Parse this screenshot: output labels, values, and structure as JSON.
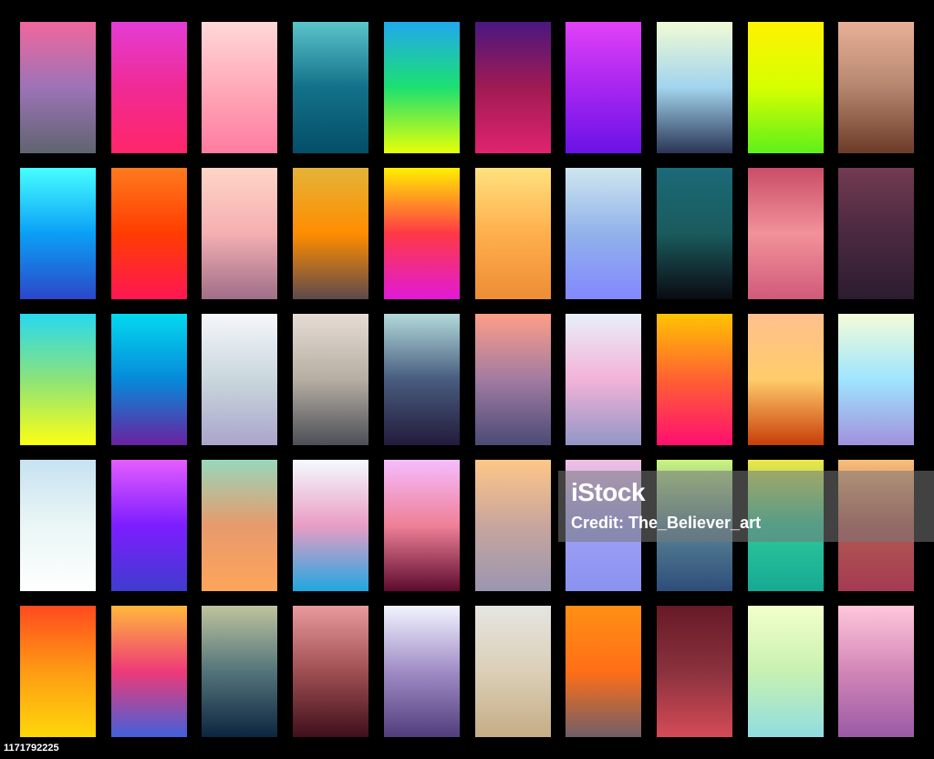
{
  "watermark": {
    "logo": "iStock",
    "credit": "Credit: The_Believer_art"
  },
  "image_id": "1171792225",
  "swatches": [
    [
      "#f0679d",
      "#9d73b7",
      "#5f6470"
    ],
    [
      "#e33dd6",
      "#f02a95",
      "#ff2669"
    ],
    [
      "#ffd8d8",
      "#ffaab8",
      "#ff7ba0"
    ],
    [
      "#5bc4cb",
      "#137189",
      "#044e68"
    ],
    [
      "#21a8ee",
      "#1ce070",
      "#e8ff08"
    ],
    [
      "#4a1780",
      "#a01b53",
      "#e0236f"
    ],
    [
      "#e142f6",
      "#a725f0",
      "#6a12e6"
    ],
    [
      "#f1fbd4",
      "#a2d4ee",
      "#2a3555"
    ],
    [
      "#fff200",
      "#d6ff00",
      "#5ef01a"
    ],
    [
      "#e9b098",
      "#b5866e",
      "#6d3b29"
    ],
    [
      "#47ffff",
      "#0aa0f6",
      "#2b47c9"
    ],
    [
      "#ff7a1e",
      "#ff3d00",
      "#ff1654"
    ],
    [
      "#ffd5c7",
      "#f4afb1",
      "#9f6e89"
    ],
    [
      "#e4b338",
      "#ff8d00",
      "#5d494c"
    ],
    [
      "#ffef00",
      "#ff3847",
      "#e01ad7"
    ],
    [
      "#ffe17e",
      "#ffaf4d",
      "#ed8d35"
    ],
    [
      "#cfe6ee",
      "#91b2ea",
      "#8387ff"
    ],
    [
      "#1b6a78",
      "#1a5b5d",
      "#0a0a12"
    ],
    [
      "#ca4d67",
      "#f29299",
      "#d05a7a"
    ],
    [
      "#723b52",
      "#4a2940",
      "#2c1c30"
    ],
    [
      "#28d9ef",
      "#8be37a",
      "#fcff13"
    ],
    [
      "#03d9ef",
      "#068ad9",
      "#6a22a0"
    ],
    [
      "#f5f7fc",
      "#c9d7dc",
      "#aaa5cb"
    ],
    [
      "#e6dcd5",
      "#b6aea2",
      "#4b4f56"
    ],
    [
      "#b3dada",
      "#485c7f",
      "#231b3b"
    ],
    [
      "#ff9e87",
      "#a27ba1",
      "#4a4b76"
    ],
    [
      "#e8f0fa",
      "#f3b2d8",
      "#9296c6"
    ],
    [
      "#ffc400",
      "#ff6132",
      "#ff0f70"
    ],
    [
      "#ffc08e",
      "#ffcc6a",
      "#c83d0a"
    ],
    [
      "#f4fcd8",
      "#9fe5ff",
      "#a191dd"
    ],
    [
      "#c7e2f2",
      "#eaf6f5",
      "#ffffff"
    ],
    [
      "#e55dff",
      "#7d1dff",
      "#3f3ccf"
    ],
    [
      "#97d8ba",
      "#e79a6d",
      "#ffa55a"
    ],
    [
      "#f4fbff",
      "#e99dc4",
      "#1fa7e0"
    ],
    [
      "#f5bdff",
      "#ef8097",
      "#5c0b2e"
    ],
    [
      "#ffc787",
      "#c8a59d",
      "#9a96b0"
    ],
    [
      "#f2bfe4",
      "#9fa0f4",
      "#8a92f0"
    ],
    [
      "#cbf57f",
      "#5a8596",
      "#2e4d7a"
    ],
    [
      "#f1e646",
      "#2ec99a",
      "#16a994"
    ],
    [
      "#fbc07a",
      "#b25a52",
      "#a53a52"
    ],
    [
      "#ff4a1f",
      "#ff9b14",
      "#ffd70a"
    ],
    [
      "#ffb93b",
      "#ee3a78",
      "#4260d9"
    ],
    [
      "#bfc49d",
      "#53747a",
      "#0d2540"
    ],
    [
      "#e89a9c",
      "#9f4f52",
      "#3f0f1c"
    ],
    [
      "#f1f4ff",
      "#a08cc5",
      "#523d7d"
    ],
    [
      "#e5e5e1",
      "#dbcfb7",
      "#c5ad85"
    ],
    [
      "#ff8f14",
      "#ff6f17",
      "#705e67"
    ],
    [
      "#661a26",
      "#8a323e",
      "#d44b57"
    ],
    [
      "#f3ffcc",
      "#c8f1b1",
      "#8fdde0"
    ],
    [
      "#ffc7db",
      "#d286b7",
      "#9a5aa5"
    ]
  ]
}
